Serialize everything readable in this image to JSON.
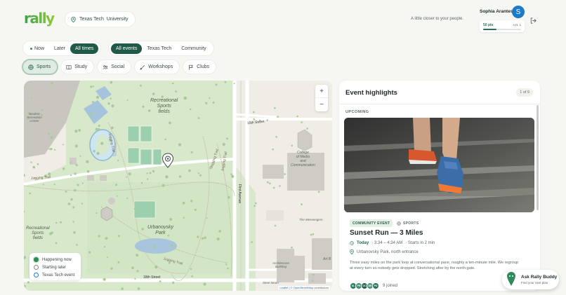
{
  "header": {
    "logo_text": "rally",
    "campus": "Texas Tech  University",
    "tagline": "A little closer to your people.",
    "user_name": "Sophia Arantes",
    "avatar_initial": "S",
    "points": "50 pts",
    "level": "LVL 1",
    "level_progress": 0.35
  },
  "time_filter": {
    "options": [
      "Now",
      "Later",
      "All times"
    ],
    "active": "All times"
  },
  "audience_filter": {
    "options": [
      "All events",
      "Texas Tech",
      "Community"
    ],
    "active": "All events"
  },
  "categories": [
    {
      "label": "Sports",
      "icon": "ball-icon",
      "active": true
    },
    {
      "label": "Study",
      "icon": "book-icon",
      "active": false
    },
    {
      "label": "Social",
      "icon": "people-icon",
      "active": false
    },
    {
      "label": "Workshops",
      "icon": "brush-icon",
      "active": false
    },
    {
      "label": "Clubs",
      "icon": "flag-icon",
      "active": false
    }
  ],
  "map": {
    "labels": {
      "rec_fields": "Recreational\nSports\nfields",
      "student_rec": "Student\nRecreation\nCenter",
      "rec_fields_2": "Recreational\nSports\nfields",
      "urbanovsky": "Urbanovsky\nPark",
      "college_media": "College\nof Media\nand\nCommunication",
      "messengers": "The Messengers",
      "architecture": "Architecture\nBuilding",
      "steel_moon": "Steel Moon",
      "art": "Art B",
      "street_15": "15th Street",
      "street_18": "18th Street",
      "flint": "Flint Avenue",
      "jogging_1": "Jogging Trail",
      "jogging_2": "Jogging Trail",
      "jogging_3": "Jogging Trail",
      "jogging_4": "Jogging Trail",
      "jogging_5": "Jogging Trail"
    },
    "zoom_in": "+",
    "zoom_out": "−",
    "legend": [
      "Happening now",
      "Starting later",
      "Texas Tech event"
    ],
    "attribution_leaflet": "Leaflet",
    "attribution_sep": " | © ",
    "attribution_osm": "OpenStreetMap",
    "attribution_tail": " contributors"
  },
  "highlights": {
    "title": "Event highlights",
    "counter": "1 of 9",
    "section": "UPCOMING",
    "event": {
      "type_tag": "COMMUNITY EVENT",
      "category_tag": "SPORTS",
      "title": "Sunset Run — 3 Miles",
      "day": "Today",
      "time": "· 3:34 – 4:34 AM",
      "starts_in": "· Starts in 2 min",
      "location": "Urbanovsky Park, north entrance",
      "description": "Three easy miles on the park loop at conversational pace, roughly a ten-minute mile. We regroup at every turn so nobody gets dropped. Stretching after by the north gate.",
      "attendee_initials": [
        "SL",
        "PR",
        "OC",
        "DE",
        "PD"
      ],
      "joined": "9 joined"
    }
  },
  "assistant": {
    "title": "Ask Rally Buddy",
    "subtitle": "Find your next plan"
  },
  "colors": {
    "brand": "#1f5a49",
    "accent_blue": "#1b7ac9",
    "park_green": "#d5e8cc"
  }
}
